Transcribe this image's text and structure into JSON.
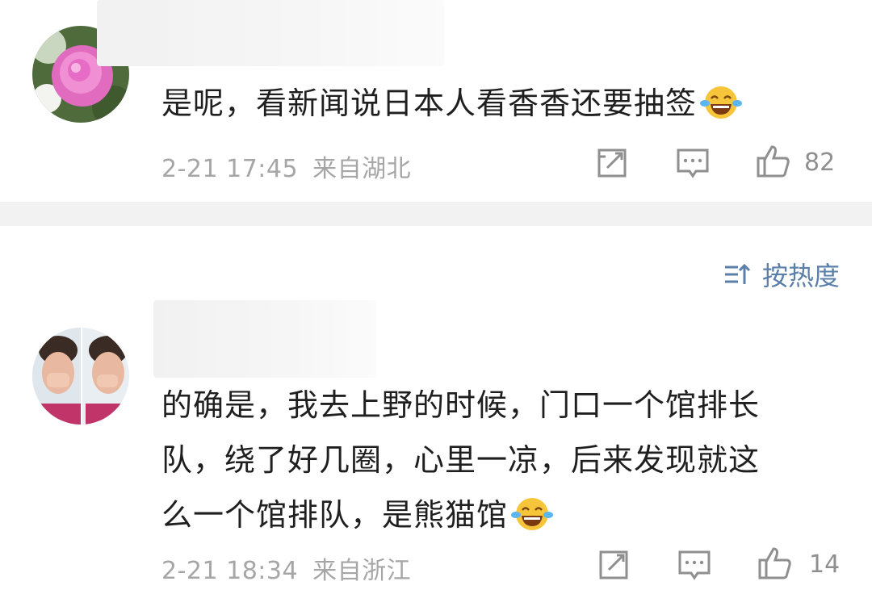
{
  "comments": [
    {
      "text": "是呢，看新闻说日本人看香香还要抽签",
      "emoji": "laughing-crying-emoji",
      "date": "2-21 17:45",
      "location": "来自湖北",
      "likes": "82"
    },
    {
      "text_lines": [
        "的确是，我去上野的时候，门口一个馆排长",
        "队，绕了好几圈，心里一凉，后来发现就这",
        "么一个馆排队，是熊猫馆"
      ],
      "emoji": "laughing-crying-emoji",
      "date": "2-21 18:34",
      "location": "来自浙江",
      "likes": "14"
    }
  ],
  "sort": {
    "label": "按热度",
    "icon": "sort-icon"
  },
  "icons": {
    "repost": "repost-icon",
    "comment": "comment-icon",
    "like": "thumbs-up-icon"
  },
  "colors": {
    "meta_text": "#a6a6a6",
    "sort_accent": "#5a7fa8",
    "divider": "#f2f2f2"
  }
}
